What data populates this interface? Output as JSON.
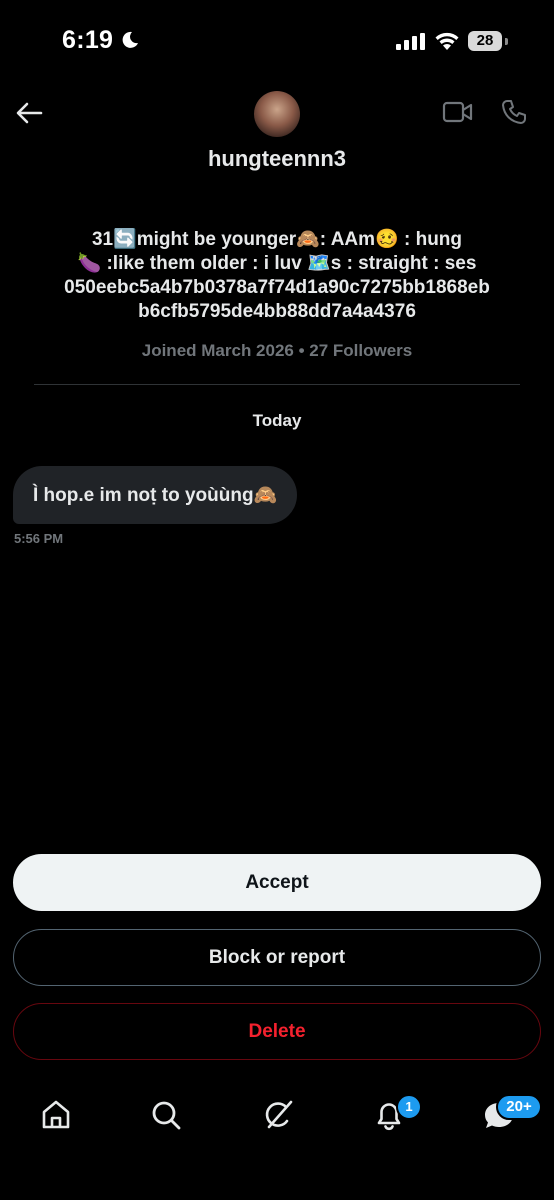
{
  "status_bar": {
    "time": "6:19",
    "battery": "28",
    "icons": [
      "moon-icon",
      "cellular-signal-icon",
      "wifi-icon",
      "battery-icon"
    ]
  },
  "header": {
    "username": "hungteennn3",
    "icons": [
      "back-arrow-icon",
      "video-call-icon",
      "phone-icon"
    ]
  },
  "profile": {
    "bio_lines": [
      "31🔄might be younger🙈:  AAm🥴  :  hung",
      "🍆  :like them older  :  i luv 🗺️s  :  straight  : ses",
      "050eebc5a4b7b0378a7f74d1a90c7275bb1868eb",
      "b6cfb5795de4bb88dd7a4a4376"
    ],
    "joined": "Joined March 2026 • 27 Followers"
  },
  "conversation": {
    "day_label": "Today",
    "messages": [
      {
        "text": "Ì hop.e im noṭ to yoùùng🙈",
        "time": "5:56 PM"
      }
    ]
  },
  "actions": {
    "accept": "Accept",
    "block_report": "Block or report",
    "delete": "Delete"
  },
  "bottom_nav": {
    "items": [
      "home-icon",
      "search-icon",
      "grok-icon",
      "notifications-icon",
      "messages-icon"
    ],
    "notifications_badge": "1",
    "messages_badge": "20+"
  },
  "colors": {
    "background": "#000000",
    "bubble": "#202327",
    "accent": "#1d9bf0",
    "danger": "#f4212e",
    "muted": "#71767b"
  }
}
